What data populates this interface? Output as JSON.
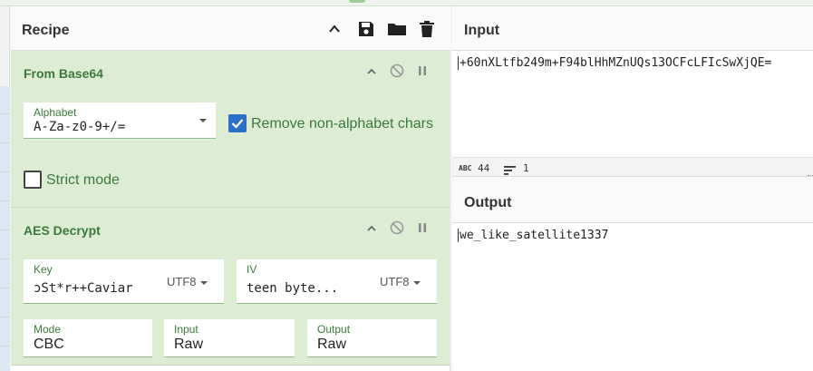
{
  "recipe": {
    "title": "Recipe"
  },
  "operations": [
    {
      "title": "From Base64",
      "alphabet_label": "Alphabet",
      "alphabet_value": "A-Za-z0-9+/=",
      "remove_label": "Remove non-alphabet chars",
      "remove_checked": true,
      "strict_label": "Strict mode",
      "strict_checked": false
    },
    {
      "title": "AES Decrypt",
      "key_label": "Key",
      "key_value": "ɔSt*r++Caviar",
      "key_encoding": "UTF8",
      "iv_label": "IV",
      "iv_value": "teen byte...",
      "iv_encoding": "UTF8",
      "mode_label": "Mode",
      "mode_value": "CBC",
      "input_label": "Input",
      "input_value": "Raw",
      "output_label": "Output",
      "output_value": "Raw"
    }
  ],
  "input": {
    "title": "Input",
    "text": "+60nXLtfb249m+F94blHhMZnUQs13OCFcLFIcSwXjQE=",
    "length": "44",
    "lines": "1"
  },
  "output": {
    "title": "Output",
    "text": "we_like_satellite1337"
  },
  "colors": {
    "accent_green": "#3a7a3a",
    "op_background": "#dcedd4",
    "checkbox_blue": "#2a6fc9"
  }
}
